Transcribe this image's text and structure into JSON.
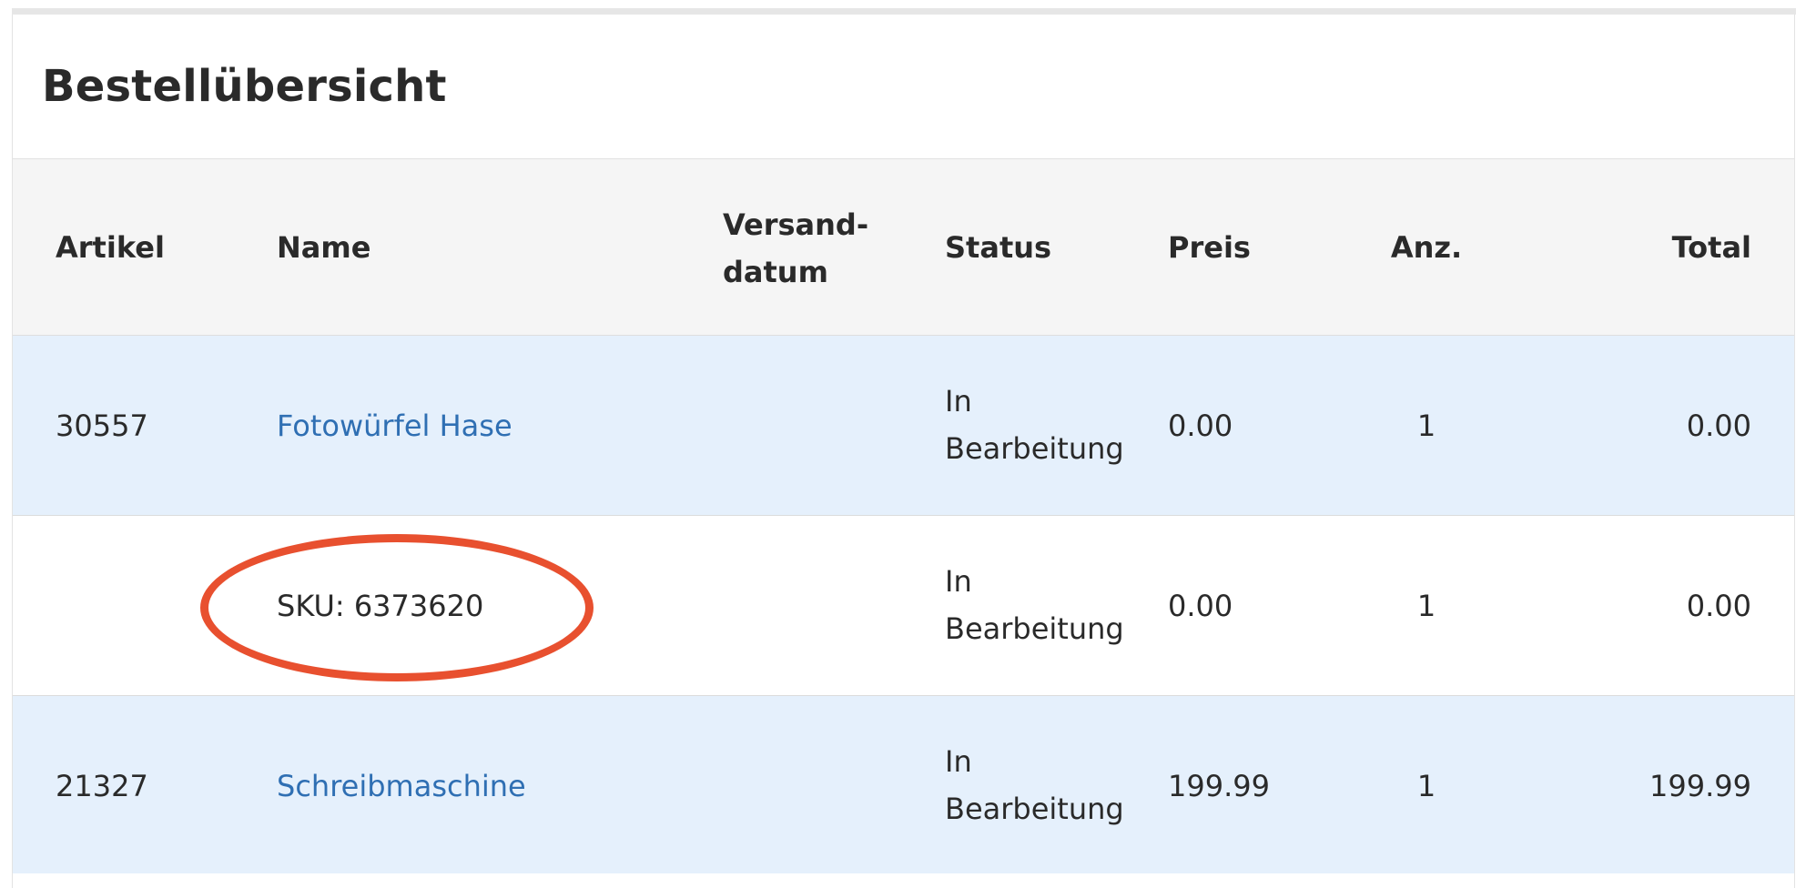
{
  "page": {
    "title": "Bestellübersicht"
  },
  "table": {
    "headers": {
      "artikel": "Artikel",
      "name": "Name",
      "versand_line1": "Versand-",
      "versand_line2": "datum",
      "status": "Status",
      "preis": "Preis",
      "anz": "Anz.",
      "total": "Total"
    },
    "rows": [
      {
        "artikel": "30557",
        "name": "Fotowürfel Hase",
        "versanddatum": "",
        "status_line1": "In",
        "status_line2": "Bearbeitung",
        "preis": "0.00",
        "anz": "1",
        "total": "0.00"
      },
      {
        "artikel": "",
        "name": "SKU: 6373620",
        "versanddatum": "",
        "status_line1": "In",
        "status_line2": "Bearbeitung",
        "preis": "0.00",
        "anz": "1",
        "total": "0.00"
      },
      {
        "artikel": "21327",
        "name": "Schreibmaschine",
        "versanddatum": "",
        "status_line1": "In",
        "status_line2": "Bearbeitung",
        "preis": "199.99",
        "anz": "1",
        "total": "199.99"
      }
    ]
  },
  "colors": {
    "link": "#2f6fb3",
    "row_highlight": "#e5f0fc",
    "header_bg": "#f5f5f5",
    "annotation": "#e8502f"
  }
}
